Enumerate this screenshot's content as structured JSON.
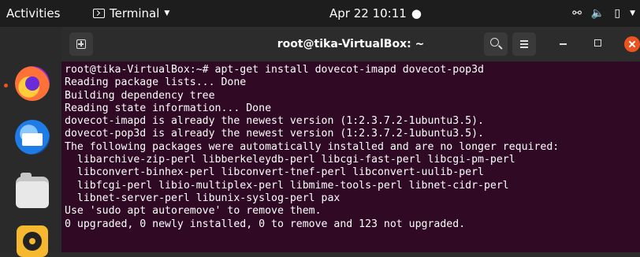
{
  "topbar": {
    "activities": "Activities",
    "app_name": "Terminal",
    "clock": "Apr 22  10:11",
    "notification_dot": "●"
  },
  "dock": {
    "items": [
      {
        "name": "firefox",
        "icon": "firefox-icon"
      },
      {
        "name": "thunderbird",
        "icon": "thunderbird-icon"
      },
      {
        "name": "files",
        "icon": "files-icon"
      },
      {
        "name": "rhythmbox",
        "icon": "rhythmbox-icon"
      }
    ]
  },
  "window": {
    "title": "root@tika-VirtualBox: ~",
    "accent": "#e95420",
    "background": "#300a24"
  },
  "terminal": {
    "lines": [
      "root@tika-VirtualBox:~# apt-get install dovecot-imapd dovecot-pop3d",
      "Reading package lists... Done",
      "Building dependency tree",
      "Reading state information... Done",
      "dovecot-imapd is already the newest version (1:2.3.7.2-1ubuntu3.5).",
      "dovecot-pop3d is already the newest version (1:2.3.7.2-1ubuntu3.5).",
      "The following packages were automatically installed and are no longer required:",
      "  libarchive-zip-perl libberkeleydb-perl libcgi-fast-perl libcgi-pm-perl",
      "  libconvert-binhex-perl libconvert-tnef-perl libconvert-uulib-perl",
      "  libfcgi-perl libio-multiplex-perl libmime-tools-perl libnet-cidr-perl",
      "  libnet-server-perl libunix-syslog-perl pax",
      "Use 'sudo apt autoremove' to remove them.",
      "0 upgraded, 0 newly installed, 0 to remove and 123 not upgraded."
    ]
  }
}
